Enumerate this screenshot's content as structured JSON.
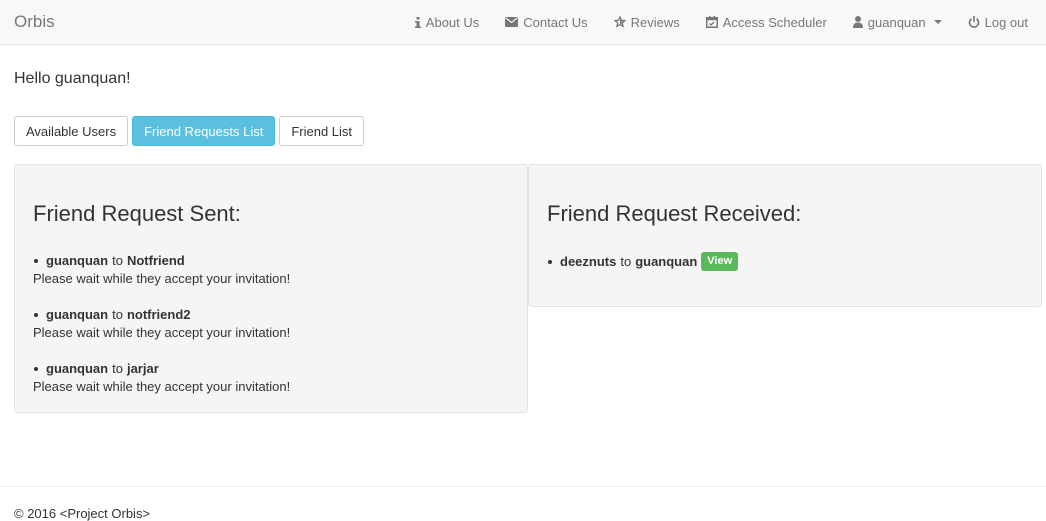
{
  "navbar": {
    "brand": "Orbis",
    "items": [
      {
        "label": "About Us",
        "icon": "info-icon"
      },
      {
        "label": "Contact Us",
        "icon": "envelope-icon"
      },
      {
        "label": "Reviews",
        "icon": "star-icon"
      },
      {
        "label": "Access Scheduler",
        "icon": "calendar-icon"
      },
      {
        "label": "guanquan",
        "icon": "user-icon"
      },
      {
        "label": "Log out",
        "icon": "power-icon"
      }
    ]
  },
  "greeting": "Hello guanquan!",
  "tabs": [
    {
      "label": "Available Users",
      "active": false
    },
    {
      "label": "Friend Requests List",
      "active": true
    },
    {
      "label": "Friend List",
      "active": false
    }
  ],
  "sent": {
    "title": "Friend Request Sent:",
    "items": [
      {
        "from": "guanquan",
        "connector": "to",
        "to": "Notfriend",
        "note": "Please wait while they accept your invitation!"
      },
      {
        "from": "guanquan",
        "connector": "to",
        "to": "notfriend2",
        "note": "Please wait while they accept your invitation!"
      },
      {
        "from": "guanquan",
        "connector": "to",
        "to": "jarjar",
        "note": "Please wait while they accept your invitation!"
      }
    ]
  },
  "received": {
    "title": "Friend Request Received:",
    "items": [
      {
        "from": "deeznuts",
        "connector": "to",
        "to": "guanquan",
        "action": "View"
      }
    ]
  },
  "footer": "© 2016 <Project Orbis>",
  "colors": {
    "info": "#5bc0de",
    "success": "#5cb85c",
    "panel": "#f5f5f5"
  }
}
